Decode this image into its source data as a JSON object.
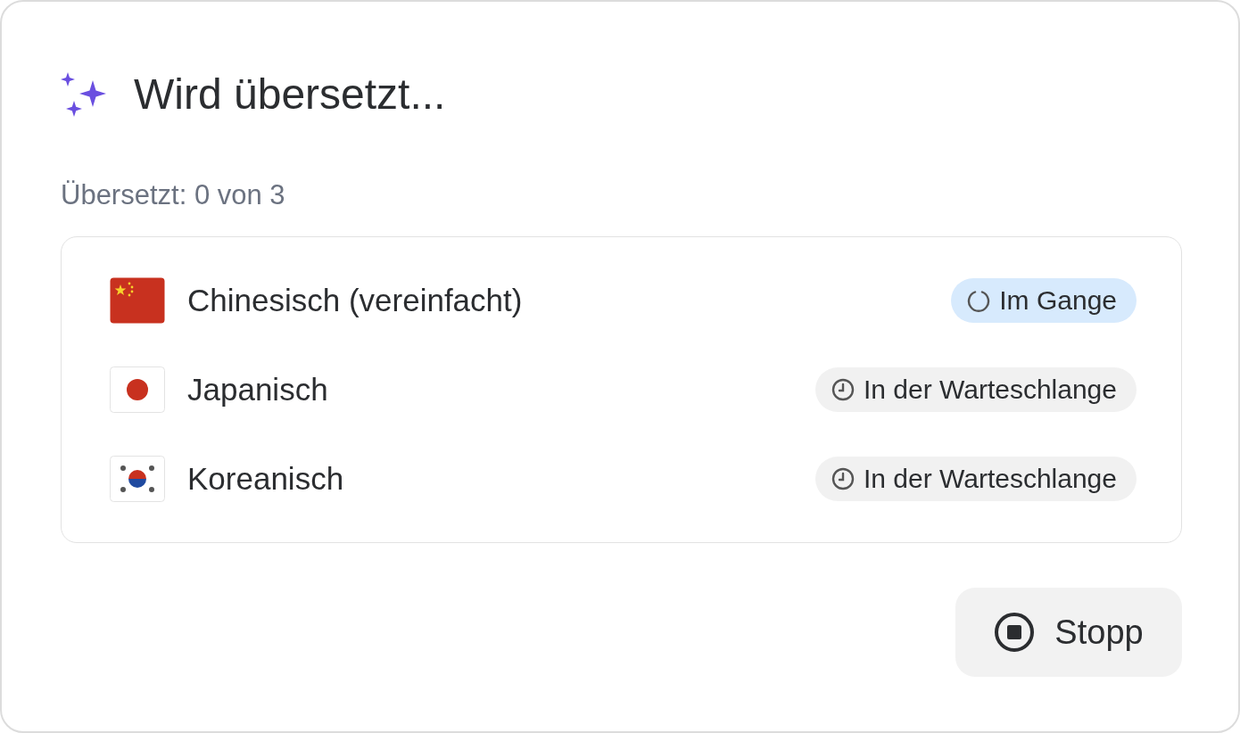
{
  "title": "Wird übersetzt...",
  "progress_text": "Übersetzt: 0 von 3",
  "languages": [
    {
      "name": "Chinesisch (vereinfacht)",
      "kind": "cn",
      "status": {
        "kind": "in_progress",
        "label": "Im Gange"
      }
    },
    {
      "name": "Japanisch",
      "kind": "jp",
      "status": {
        "kind": "queued",
        "label": "In der Warteschlange"
      }
    },
    {
      "name": "Koreanisch",
      "kind": "kr",
      "status": {
        "kind": "queued",
        "label": "In der Warteschlange"
      }
    }
  ],
  "stop_button": {
    "label": "Stopp"
  }
}
